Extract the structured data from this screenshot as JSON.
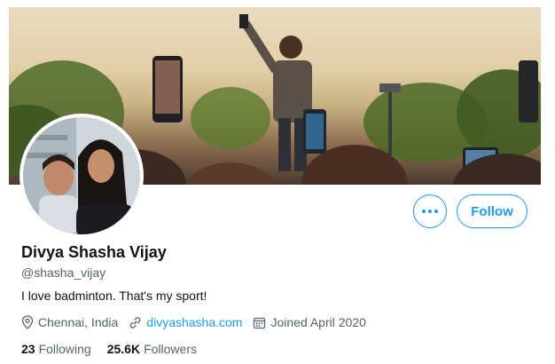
{
  "profile": {
    "name": "Divya Shasha Vijay",
    "handle": "@shasha_vijay",
    "bio": "I love badminton. That's my sport!",
    "location": "Chennai, India",
    "website": "divyashasha.com",
    "joined": "Joined April 2020"
  },
  "stats": {
    "following_count": "23",
    "following_label": "Following",
    "followers_count": "25.6K",
    "followers_label": "Followers"
  },
  "actions": {
    "follow_label": "Follow",
    "more_icon": "more-horizontal-icon"
  },
  "colors": {
    "accent": "#1d9bf0",
    "text_primary": "#0f1419",
    "text_secondary": "#536471"
  }
}
